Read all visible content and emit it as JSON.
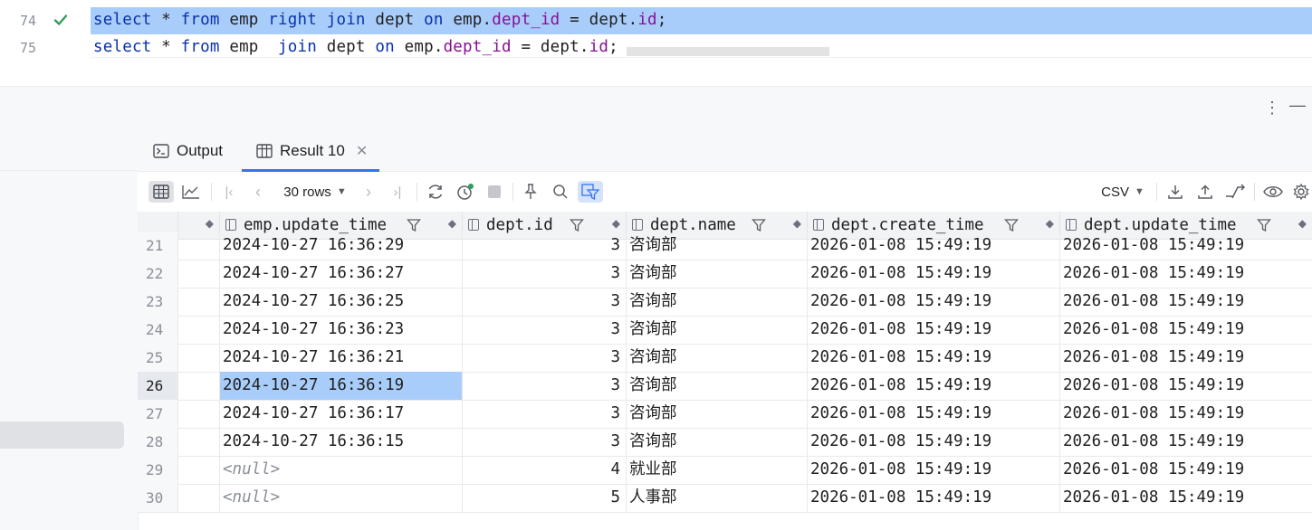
{
  "editor": {
    "lines": [
      {
        "number": "74",
        "status": "check-icon",
        "active": true,
        "tokens": [
          {
            "t": "select",
            "c": "kw"
          },
          {
            "t": " * ",
            "c": ""
          },
          {
            "t": "from",
            "c": "kw"
          },
          {
            "t": " emp ",
            "c": ""
          },
          {
            "t": "right",
            "c": "kw"
          },
          {
            "t": " ",
            "c": ""
          },
          {
            "t": "join",
            "c": "kw"
          },
          {
            "t": " dept ",
            "c": ""
          },
          {
            "t": "on",
            "c": "kw"
          },
          {
            "t": " emp.",
            "c": ""
          },
          {
            "t": "dept_id",
            "c": "fld"
          },
          {
            "t": " = dept.",
            "c": ""
          },
          {
            "t": "id",
            "c": "fld"
          },
          {
            "t": ";",
            "c": ""
          }
        ]
      },
      {
        "number": "75",
        "status": "",
        "active": false,
        "tokens": [
          {
            "t": "select",
            "c": "kw"
          },
          {
            "t": " * ",
            "c": ""
          },
          {
            "t": "from",
            "c": "kw"
          },
          {
            "t": " emp  ",
            "c": ""
          },
          {
            "t": "join",
            "c": "kw"
          },
          {
            "t": " dept ",
            "c": ""
          },
          {
            "t": "on",
            "c": "kw"
          },
          {
            "t": " emp.",
            "c": ""
          },
          {
            "t": "dept_id",
            "c": "fld"
          },
          {
            "t": " = dept.",
            "c": ""
          },
          {
            "t": "id",
            "c": "fld"
          },
          {
            "t": ";",
            "c": ""
          }
        ]
      }
    ]
  },
  "tabs": [
    {
      "label": "Output",
      "icon": "console-icon",
      "active": false
    },
    {
      "label": "Result 10",
      "icon": "table-icon",
      "active": true,
      "closable": true
    }
  ],
  "toolbar": {
    "rows_label": "30 rows",
    "export_format": "CSV"
  },
  "grid": {
    "columns": [
      "emp.update_time",
      "dept.id",
      "dept.name",
      "dept.create_time",
      "dept.update_time"
    ],
    "rows": [
      {
        "n": "21",
        "update_time": "2024-10-27 16:36:29",
        "id": "3",
        "name": "咨询部",
        "create_time": "2026-01-08 15:49:19",
        "dept_update_time": "2026-01-08 15:49:19"
      },
      {
        "n": "22",
        "update_time": "2024-10-27 16:36:27",
        "id": "3",
        "name": "咨询部",
        "create_time": "2026-01-08 15:49:19",
        "dept_update_time": "2026-01-08 15:49:19"
      },
      {
        "n": "23",
        "update_time": "2024-10-27 16:36:25",
        "id": "3",
        "name": "咨询部",
        "create_time": "2026-01-08 15:49:19",
        "dept_update_time": "2026-01-08 15:49:19"
      },
      {
        "n": "24",
        "update_time": "2024-10-27 16:36:23",
        "id": "3",
        "name": "咨询部",
        "create_time": "2026-01-08 15:49:19",
        "dept_update_time": "2026-01-08 15:49:19"
      },
      {
        "n": "25",
        "update_time": "2024-10-27 16:36:21",
        "id": "3",
        "name": "咨询部",
        "create_time": "2026-01-08 15:49:19",
        "dept_update_time": "2026-01-08 15:49:19"
      },
      {
        "n": "26",
        "update_time": "2024-10-27 16:36:19",
        "id": "3",
        "name": "咨询部",
        "create_time": "2026-01-08 15:49:19",
        "dept_update_time": "2026-01-08 15:49:19",
        "current": true
      },
      {
        "n": "27",
        "update_time": "2024-10-27 16:36:17",
        "id": "3",
        "name": "咨询部",
        "create_time": "2026-01-08 15:49:19",
        "dept_update_time": "2026-01-08 15:49:19"
      },
      {
        "n": "28",
        "update_time": "2024-10-27 16:36:15",
        "id": "3",
        "name": "咨询部",
        "create_time": "2026-01-08 15:49:19",
        "dept_update_time": "2026-01-08 15:49:19"
      },
      {
        "n": "29",
        "update_time": "<null>",
        "id": "4",
        "name": "就业部",
        "create_time": "2026-01-08 15:49:19",
        "dept_update_time": "2026-01-08 15:49:19"
      },
      {
        "n": "30",
        "update_time": "<null>",
        "id": "5",
        "name": "人事部",
        "create_time": "2026-01-08 15:49:19",
        "dept_update_time": "2026-01-08 15:49:19"
      }
    ]
  },
  "colors": {
    "accent": "#3574f0",
    "selection": "#a9cdfa",
    "keyword": "#0a32a8",
    "field": "#871094",
    "check": "#2e9e5b"
  }
}
